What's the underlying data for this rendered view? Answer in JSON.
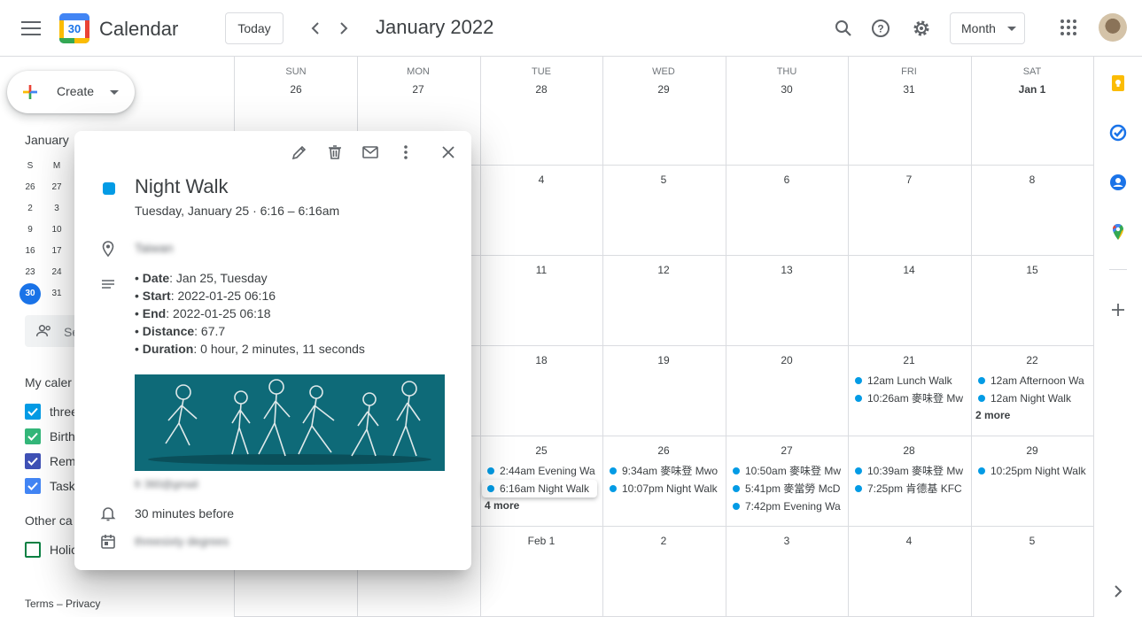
{
  "header": {
    "app_title": "Calendar",
    "logo_day": "30",
    "today_label": "Today",
    "period": "January 2022",
    "view": "Month"
  },
  "sidebar": {
    "create_label": "Create",
    "mini_month_title": "January",
    "mini_dows": [
      "S",
      "M"
    ],
    "mini_days": [
      [
        "26",
        "27"
      ],
      [
        "2",
        "3"
      ],
      [
        "9",
        "10"
      ],
      [
        "16",
        "17"
      ],
      [
        "23",
        "24"
      ],
      [
        "30",
        "31"
      ]
    ],
    "search_people": "Se",
    "my_calendars_title": "My caler",
    "my_calendars": [
      {
        "label": "three",
        "color": "#039be5"
      },
      {
        "label": "Birth",
        "color": "#33b679"
      },
      {
        "label": "Rem",
        "color": "#3f51b5"
      },
      {
        "label": "Task",
        "color": "#4285f4"
      }
    ],
    "other_calendars_title": "Other ca",
    "other_calendars": [
      {
        "label": "Holic",
        "color": "#0b8043"
      }
    ],
    "footer": "Terms – Privacy"
  },
  "month": {
    "dows": [
      "SUN",
      "MON",
      "TUE",
      "WED",
      "THU",
      "FRI",
      "SAT"
    ],
    "weeks": [
      [
        "26",
        "27",
        "28",
        "29",
        "30",
        "31",
        "Jan 1"
      ],
      [
        "",
        "",
        "4",
        "5",
        "6",
        "7",
        "8"
      ],
      [
        "",
        "",
        "11",
        "12",
        "13",
        "14",
        "15"
      ],
      [
        "",
        "",
        "18",
        "19",
        "20",
        "21",
        "22"
      ],
      [
        "",
        "",
        "25",
        "26",
        "27",
        "28",
        "29"
      ],
      [
        "",
        "",
        "Feb 1",
        "2",
        "3",
        "4",
        "5"
      ]
    ],
    "events": {
      "w3_fri": [
        {
          "time": "12am",
          "title": "Lunch Walk"
        },
        {
          "time": "10:26am",
          "title": "麥味登 Mw"
        }
      ],
      "w3_sat": [
        {
          "time": "12am",
          "title": "Afternoon Wa"
        },
        {
          "time": "12am",
          "title": "Night Walk"
        }
      ],
      "w3_sat_more": "2 more",
      "w4_tue": [
        {
          "time": "2:44am",
          "title": "Evening Wa"
        },
        {
          "time": "6:16am",
          "title": "Night Walk"
        }
      ],
      "w4_tue_more": "4 more",
      "w4_wed": [
        {
          "time": "9:34am",
          "title": "麥味登 Mwo"
        },
        {
          "time": "10:07pm",
          "title": "Night Walk"
        }
      ],
      "w4_thu": [
        {
          "time": "10:50am",
          "title": "麥味登 Mw"
        },
        {
          "time": "5:41pm",
          "title": "麥當勞 McD"
        },
        {
          "time": "7:42pm",
          "title": "Evening Wa"
        }
      ],
      "w4_fri": [
        {
          "time": "10:39am",
          "title": "麥味登 Mw"
        },
        {
          "time": "7:25pm",
          "title": "肯德基 KFC"
        }
      ],
      "w4_sat": [
        {
          "time": "10:25pm",
          "title": "Night Walk"
        }
      ]
    }
  },
  "popup": {
    "title": "Night Walk",
    "subtitle": "Tuesday, January 25  ·  6:16 – 6:16am",
    "location": "Taiwan",
    "desc": [
      {
        "k": "Date",
        "v": ": Jan 25, Tuesday"
      },
      {
        "k": "Start",
        "v": ": 2022-01-25 06:16"
      },
      {
        "k": "End",
        "v": ": 2022-01-25 06:18"
      },
      {
        "k": "Distance",
        "v": ": 67.7"
      },
      {
        "k": "Duration",
        "v": ": 0 hour, 2 minutes, 11 seconds"
      }
    ],
    "organizer": "fr 360@gmail",
    "reminder": "30 minutes before",
    "calendar_name": "threesixty degrees",
    "event_color": "#039be5"
  }
}
